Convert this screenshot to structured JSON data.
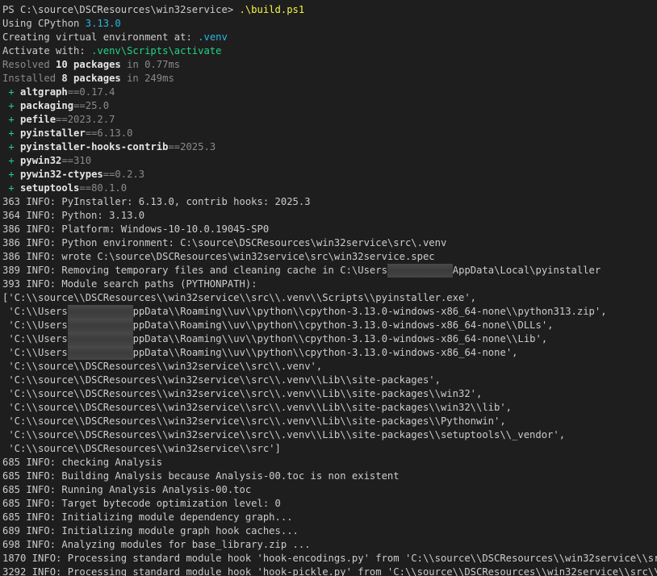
{
  "terminal": {
    "lines": [
      [
        {
          "t": "PS C:\\source\\DSCResources\\win32service> "
        },
        {
          "t": ".\\build.ps1",
          "c": "yellow"
        }
      ],
      [
        {
          "t": "Using CPython "
        },
        {
          "t": "3.13.0",
          "c": "teal"
        }
      ],
      [
        {
          "t": "Creating virtual environment at: "
        },
        {
          "t": ".venv",
          "c": "teal"
        }
      ],
      [
        {
          "t": "Activate with: "
        },
        {
          "t": ".venv\\Scripts\\activate",
          "c": "green"
        }
      ],
      [
        {
          "t": "Resolved ",
          "c": "dim"
        },
        {
          "t": "10 packages",
          "c": "bold"
        },
        {
          "t": " in 0.77ms",
          "c": "dim"
        }
      ],
      [
        {
          "t": "Installed ",
          "c": "dim"
        },
        {
          "t": "8 packages",
          "c": "bold"
        },
        {
          "t": " in 249ms",
          "c": "dim"
        }
      ],
      [
        {
          "t": " + ",
          "c": "green"
        },
        {
          "t": "altgraph",
          "c": "bold"
        },
        {
          "t": "==0.17.4",
          "c": "dim"
        }
      ],
      [
        {
          "t": " + ",
          "c": "green"
        },
        {
          "t": "packaging",
          "c": "bold"
        },
        {
          "t": "==25.0",
          "c": "dim"
        }
      ],
      [
        {
          "t": " + ",
          "c": "green"
        },
        {
          "t": "pefile",
          "c": "bold"
        },
        {
          "t": "==2023.2.7",
          "c": "dim"
        }
      ],
      [
        {
          "t": " + ",
          "c": "green"
        },
        {
          "t": "pyinstaller",
          "c": "bold"
        },
        {
          "t": "==6.13.0",
          "c": "dim"
        }
      ],
      [
        {
          "t": " + ",
          "c": "green"
        },
        {
          "t": "pyinstaller-hooks-contrib",
          "c": "bold"
        },
        {
          "t": "==2025.3",
          "c": "dim"
        }
      ],
      [
        {
          "t": " + ",
          "c": "green"
        },
        {
          "t": "pywin32",
          "c": "bold"
        },
        {
          "t": "==310",
          "c": "dim"
        }
      ],
      [
        {
          "t": " + ",
          "c": "green"
        },
        {
          "t": "pywin32-ctypes",
          "c": "bold"
        },
        {
          "t": "==0.2.3",
          "c": "dim"
        }
      ],
      [
        {
          "t": " + ",
          "c": "green"
        },
        {
          "t": "setuptools",
          "c": "bold"
        },
        {
          "t": "==80.1.0",
          "c": "dim"
        }
      ],
      [
        {
          "t": "363 INFO: PyInstaller: 6.13.0, contrib hooks: 2025.3"
        }
      ],
      [
        {
          "t": "364 INFO: Python: 3.13.0"
        }
      ],
      [
        {
          "t": "386 INFO: Platform: Windows-10-10.0.19045-SP0"
        }
      ],
      [
        {
          "t": "386 INFO: Python environment: C:\\source\\DSCResources\\win32service\\src\\.venv"
        }
      ],
      [
        {
          "t": "386 INFO: wrote C:\\source\\DSCResources\\win32service\\src\\win32service.spec"
        }
      ],
      [
        {
          "t": "389 INFO: Removing temporary files and cleaning cache in C:\\Users"
        },
        {
          "redact": 11
        },
        {
          "t": "AppData\\Local\\pyinstaller"
        }
      ],
      [
        {
          "t": "393 INFO: Module search paths (PYTHONPATH):"
        }
      ],
      [
        {
          "t": "['C:\\\\source\\\\DSCResources\\\\win32service\\\\src\\\\.venv\\\\Scripts\\\\pyinstaller.exe',"
        }
      ],
      [
        {
          "t": " 'C:\\\\Users"
        },
        {
          "redact": 11
        },
        {
          "t": "ppData\\\\Roaming\\\\uv\\\\python\\\\cpython-3.13.0-windows-x86_64-none\\\\python313.zip',"
        }
      ],
      [
        {
          "t": " 'C:\\\\Users"
        },
        {
          "redact": 11
        },
        {
          "t": "ppData\\\\Roaming\\\\uv\\\\python\\\\cpython-3.13.0-windows-x86_64-none\\\\DLLs',"
        }
      ],
      [
        {
          "t": " 'C:\\\\Users"
        },
        {
          "redact": 11
        },
        {
          "t": "ppData\\\\Roaming\\\\uv\\\\python\\\\cpython-3.13.0-windows-x86_64-none\\\\Lib',"
        }
      ],
      [
        {
          "t": " 'C:\\\\Users"
        },
        {
          "redact": 11
        },
        {
          "t": "ppData\\\\Roaming\\\\uv\\\\python\\\\cpython-3.13.0-windows-x86_64-none',"
        }
      ],
      [
        {
          "t": " 'C:\\\\source\\\\DSCResources\\\\win32service\\\\src\\\\.venv',"
        }
      ],
      [
        {
          "t": " 'C:\\\\source\\\\DSCResources\\\\win32service\\\\src\\\\.venv\\\\Lib\\\\site-packages',"
        }
      ],
      [
        {
          "t": " 'C:\\\\source\\\\DSCResources\\\\win32service\\\\src\\\\.venv\\\\Lib\\\\site-packages\\\\win32',"
        }
      ],
      [
        {
          "t": " 'C:\\\\source\\\\DSCResources\\\\win32service\\\\src\\\\.venv\\\\Lib\\\\site-packages\\\\win32\\\\lib',"
        }
      ],
      [
        {
          "t": " 'C:\\\\source\\\\DSCResources\\\\win32service\\\\src\\\\.venv\\\\Lib\\\\site-packages\\\\Pythonwin',"
        }
      ],
      [
        {
          "t": " 'C:\\\\source\\\\DSCResources\\\\win32service\\\\src\\\\.venv\\\\Lib\\\\site-packages\\\\setuptools\\\\_vendor',"
        }
      ],
      [
        {
          "t": " 'C:\\\\source\\\\DSCResources\\\\win32service\\\\src']"
        }
      ],
      [
        {
          "t": "685 INFO: checking Analysis"
        }
      ],
      [
        {
          "t": "685 INFO: Building Analysis because Analysis-00.toc is non existent"
        }
      ],
      [
        {
          "t": "685 INFO: Running Analysis Analysis-00.toc"
        }
      ],
      [
        {
          "t": "685 INFO: Target bytecode optimization level: 0"
        }
      ],
      [
        {
          "t": "685 INFO: Initializing module dependency graph..."
        }
      ],
      [
        {
          "t": "689 INFO: Initializing module graph hook caches..."
        }
      ],
      [
        {
          "t": "698 INFO: Analyzing modules for base_library.zip ..."
        }
      ],
      [
        {
          "t": "1870 INFO: Processing standard module hook 'hook-encodings.py' from 'C:\\\\source\\\\DSCResources\\\\win32service\\\\src\\\\.v"
        }
      ],
      [
        {
          "t": "3292 INFO: Processing standard module hook 'hook-pickle.py' from 'C:\\\\source\\\\DSCResources\\\\win32service\\\\src\\\\.venv"
        }
      ]
    ]
  }
}
